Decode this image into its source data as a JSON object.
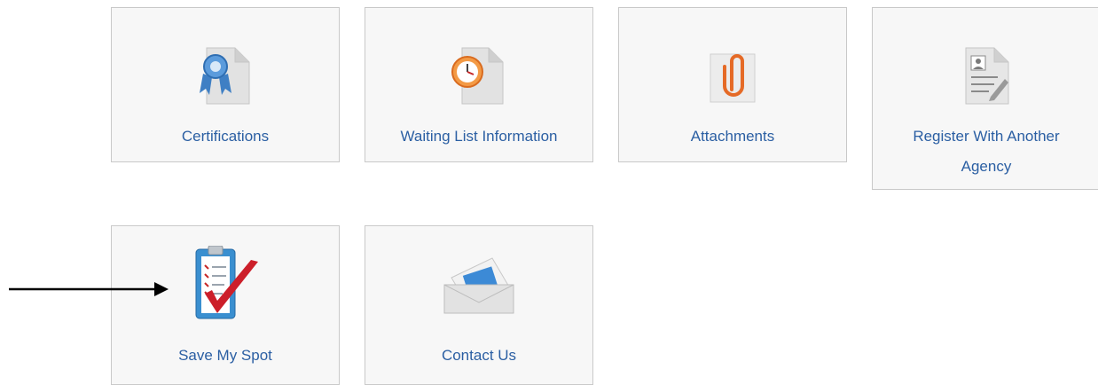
{
  "tiles": {
    "certifications": {
      "label": "Certifications",
      "icon": "certificate-ribbon-icon"
    },
    "waiting_list": {
      "label": "Waiting List Information",
      "icon": "clock-document-icon"
    },
    "attachments": {
      "label": "Attachments",
      "icon": "paperclip-icon"
    },
    "register_agency": {
      "label_line1": "Register With Another",
      "label_line2": "Agency",
      "icon": "registration-form-icon"
    },
    "save_my_spot": {
      "label": "Save My Spot",
      "icon": "clipboard-checkmark-icon"
    },
    "contact_us": {
      "label": "Contact Us",
      "icon": "envelope-icon"
    }
  },
  "annotation": {
    "icon": "pointer-arrow-icon"
  },
  "colors": {
    "label_text": "#2b5fa3",
    "tile_background": "#f7f7f7",
    "tile_border": "#c9c9c9",
    "checkmark": "#cc1f2a"
  }
}
